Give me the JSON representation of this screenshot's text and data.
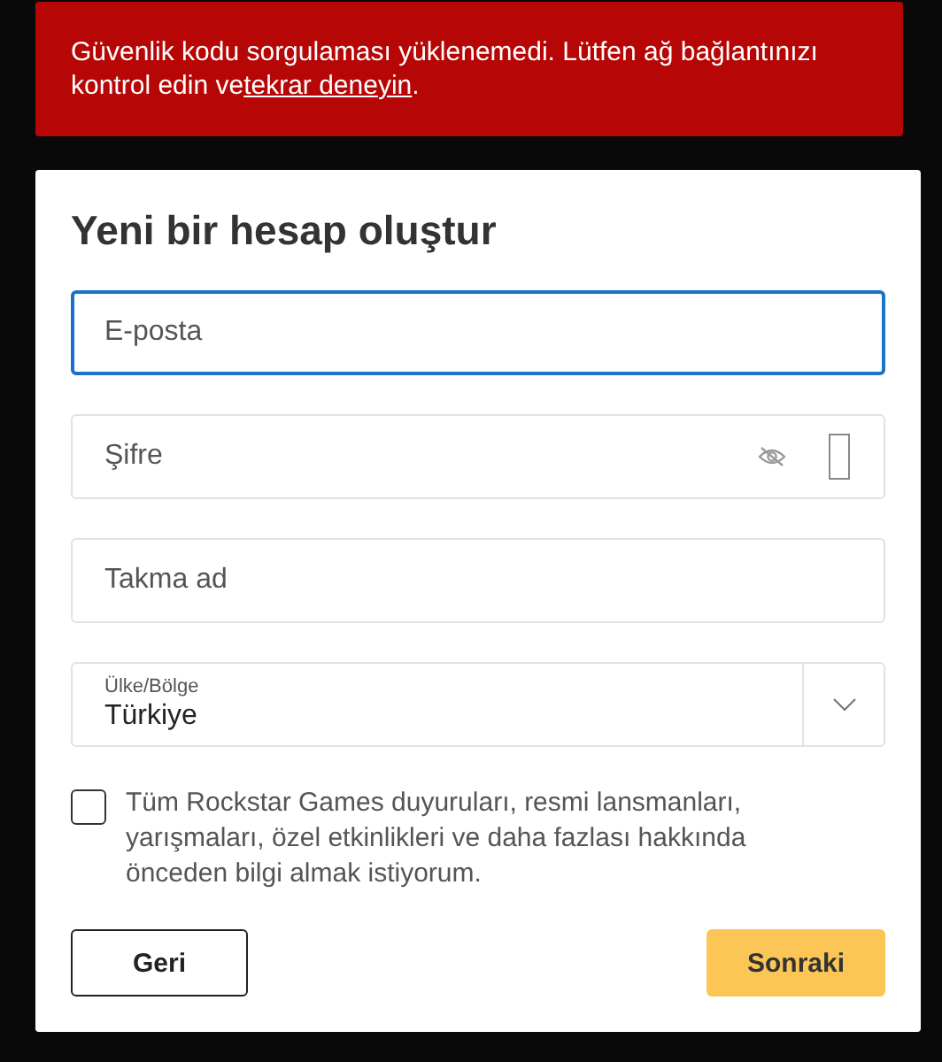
{
  "error_banner": {
    "text": "Güvenlik kodu sorgulaması yüklenemedi. Lütfen ağ bağlantınızı kontrol edin ve",
    "link": "tekrar deneyin",
    "text_after": "."
  },
  "form": {
    "title": "Yeni bir hesap oluştur",
    "fields": [
      {
        "kind": "text",
        "placeholder": "E-posta",
        "focused": true
      },
      {
        "kind": "password",
        "placeholder": "Şifre",
        "focused": false
      },
      {
        "kind": "text",
        "placeholder": "Takma ad",
        "focused": false
      },
      {
        "kind": "select",
        "label": "Ülke/Bölge",
        "value": "Türkiye",
        "focused": false
      }
    ],
    "consent": {
      "label": "Tüm Rockstar Games duyuruları, resmi lansmanları, yarışmaları, özel etkinlikleri ve daha fazlası hakkında önceden bilgi almak istiyorum.",
      "checked": false
    },
    "buttons": [
      {
        "kind": "secondary",
        "label": "Geri"
      },
      {
        "kind": "primary",
        "label": "Sonraki"
      }
    ]
  }
}
